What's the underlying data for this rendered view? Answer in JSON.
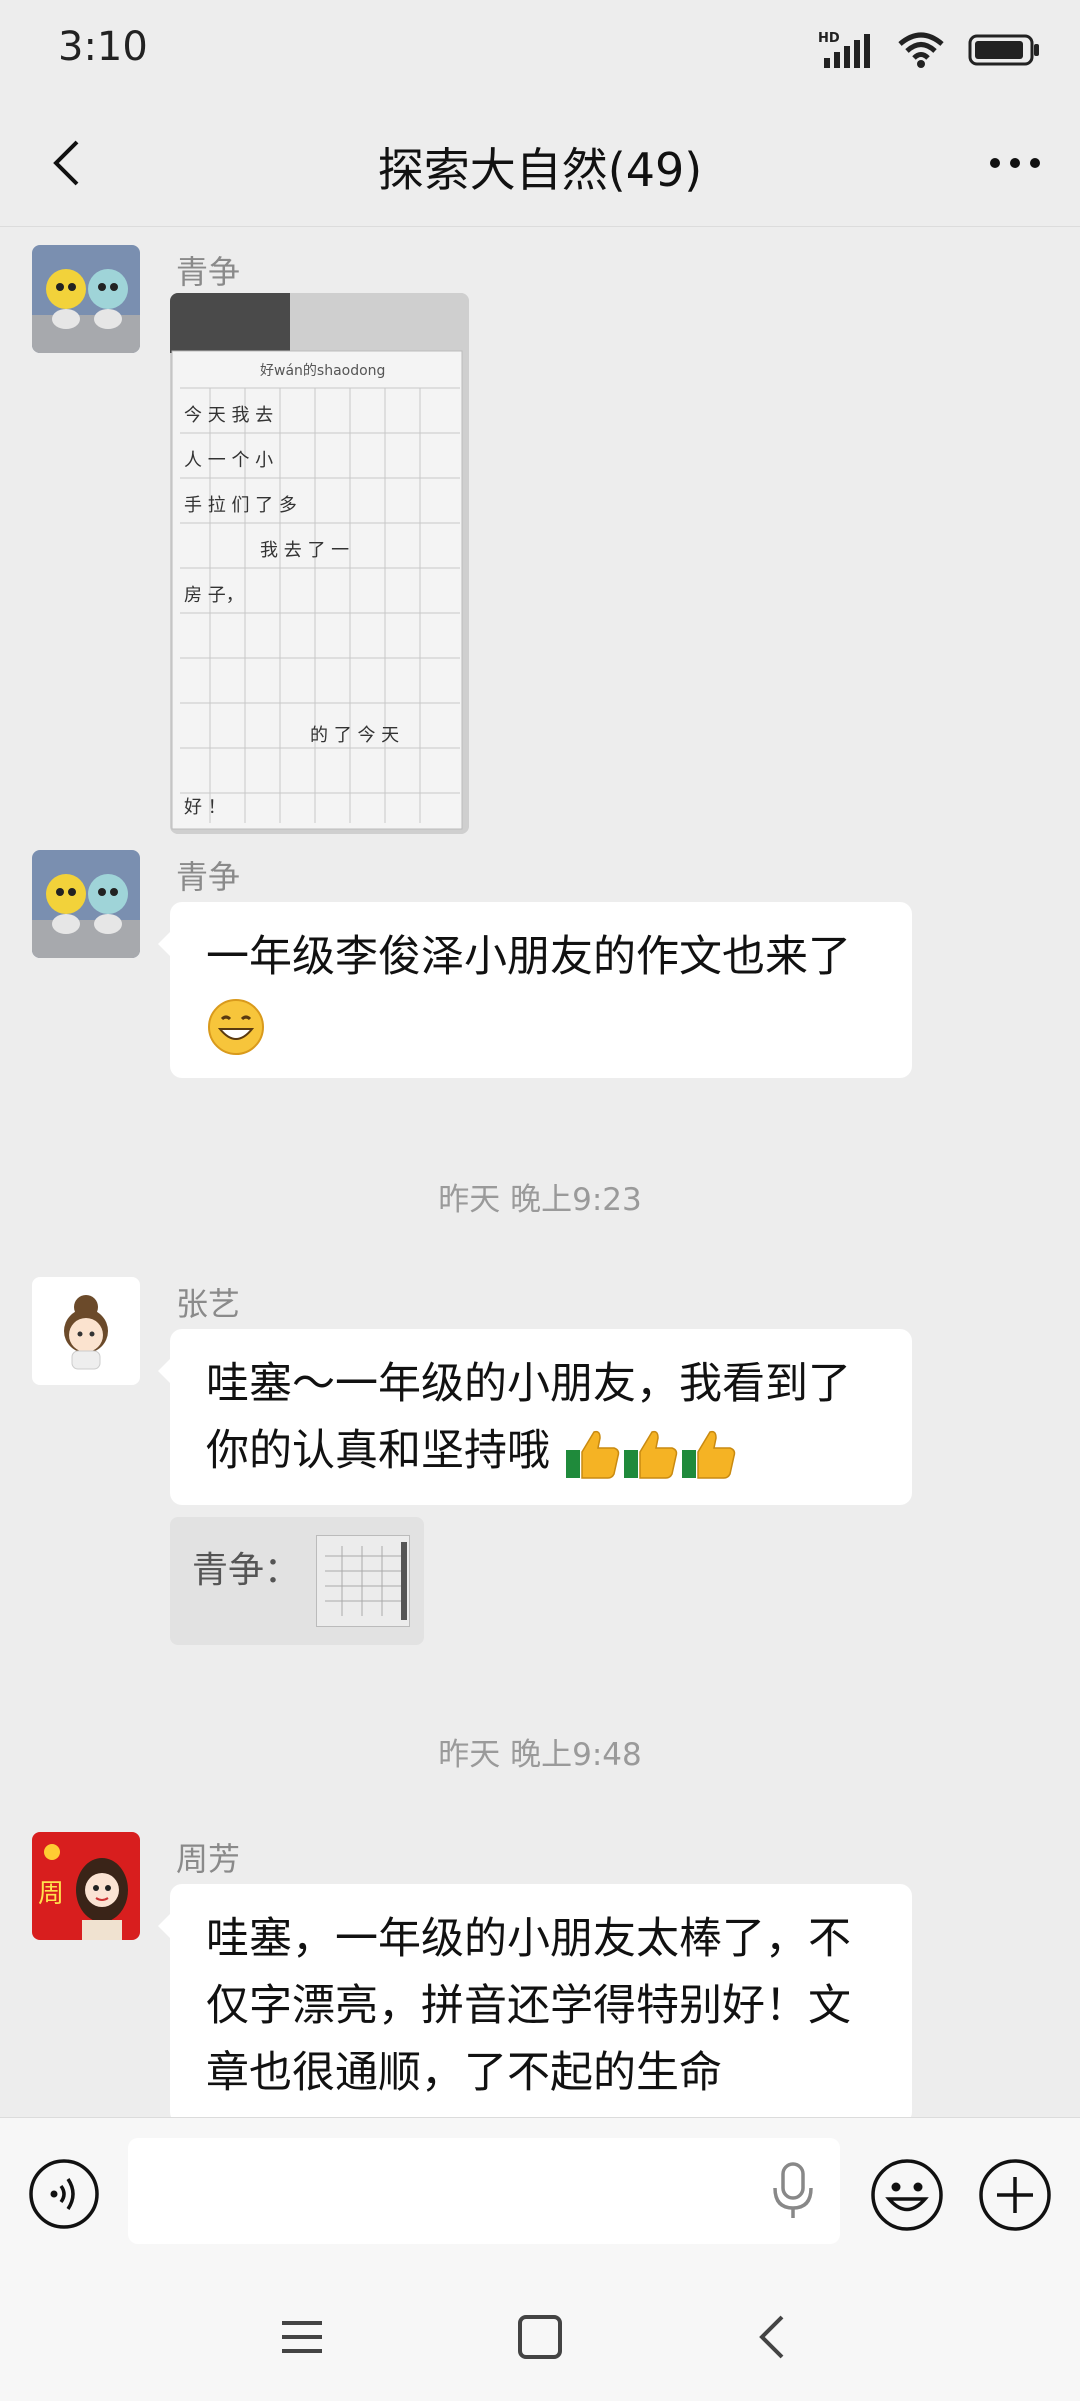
{
  "status_bar": {
    "time": "3:10",
    "network_label": "HD"
  },
  "header": {
    "title": "探索大自然(49)"
  },
  "messages": [
    {
      "sender": "青争"
    },
    {
      "sender": "青争",
      "text": "一年级李俊泽小朋友的作文也来了"
    },
    {
      "timestamp": "昨天 晚上9:23"
    },
    {
      "sender": "张艺",
      "text_line1": "哇塞～一年级的小朋友，我看到了",
      "text_line2": "你的认真和坚持哦",
      "quote_name": "青争："
    },
    {
      "timestamp": "昨天 晚上9:48"
    },
    {
      "sender": "周芳",
      "text_line1": "哇塞，一年级的小朋友太棒了，不",
      "text_line2": "仅字漂亮，拼音还学得特别好！文",
      "text_line3": "章也很通顺，了不起的生命"
    }
  ],
  "photo_preview": {
    "title": "好wán的shaodong",
    "rows": [
      "今 天 我 去",
      "人 一 个 小",
      "手 拉 们 了 多",
      "我 去 了 一",
      "房 子，",
      "的 了 今 天",
      "好 ！"
    ]
  },
  "avatar_zhoufang_char": "周",
  "input": {
    "placeholder": ""
  },
  "colors": {
    "background": "#ededed",
    "bubble": "#ffffff",
    "muted_text": "#8a8a8a",
    "bar": "#f7f7f7"
  }
}
